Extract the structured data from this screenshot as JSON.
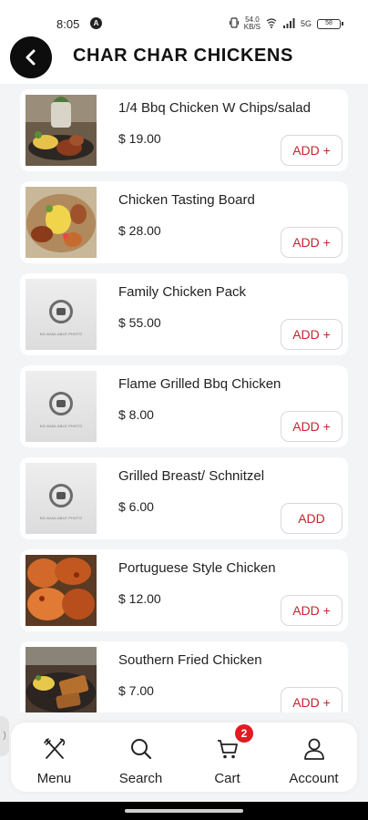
{
  "status": {
    "time": "8:05",
    "badge": "A",
    "net_top": "54.0",
    "net_bottom": "KB/S",
    "signal": "5G",
    "battery": "58"
  },
  "header": {
    "title": "CHAR CHAR CHICKENS"
  },
  "items": [
    {
      "name": "1/4 Bbq Chicken W Chips/salad",
      "price": "$ 19.00",
      "button": "ADD +",
      "image": "photo-bbq-plate"
    },
    {
      "name": "Chicken Tasting Board",
      "price": "$ 28.00",
      "button": "ADD +",
      "image": "photo-tasting-board"
    },
    {
      "name": "Family Chicken Pack",
      "price": "$ 55.00",
      "button": "ADD +",
      "image": "no-image"
    },
    {
      "name": "Flame Grilled Bbq Chicken",
      "price": "$ 8.00",
      "button": "ADD +",
      "image": "no-image"
    },
    {
      "name": "Grilled Breast/ Schnitzel",
      "price": "$ 6.00",
      "button": "ADD",
      "image": "no-image"
    },
    {
      "name": "Portuguese Style Chicken",
      "price": "$ 12.00",
      "button": "ADD +",
      "image": "photo-portuguese"
    },
    {
      "name": "Southern Fried Chicken",
      "price": "$ 7.00",
      "button": "ADD +",
      "image": "photo-southern"
    }
  ],
  "no_image_caption": "NO AVAILABLE PHOTO",
  "nav": {
    "menu": "Menu",
    "search": "Search",
    "cart": "Cart",
    "account": "Account",
    "cart_count": "2"
  },
  "colors": {
    "accent": "#c1272d",
    "badge": "#e21b23",
    "background": "#f3f4f6"
  }
}
